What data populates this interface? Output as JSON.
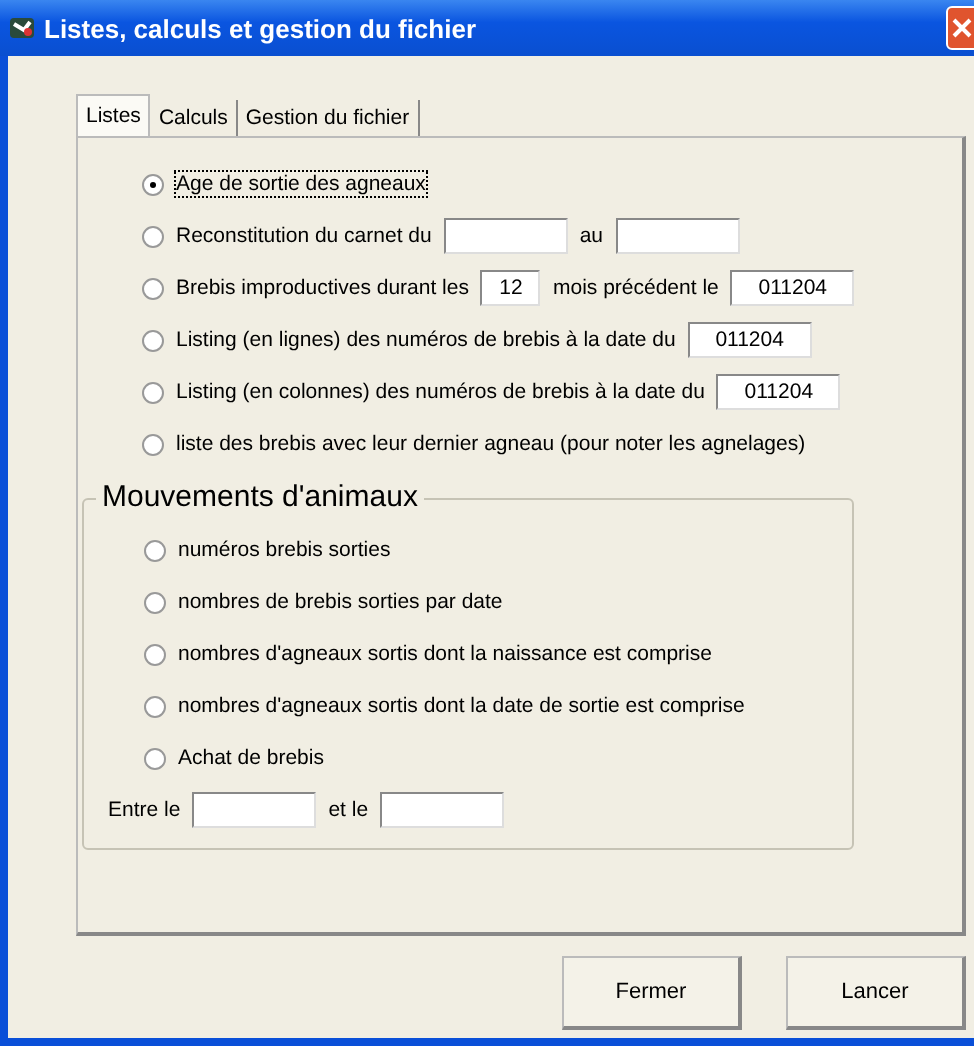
{
  "window": {
    "title": "Listes, calculs et gestion du fichier"
  },
  "tabs": [
    {
      "label": "Listes",
      "selected": true
    },
    {
      "label": "Calculs",
      "selected": false
    },
    {
      "label": "Gestion du fichier",
      "selected": false
    }
  ],
  "options": [
    {
      "selected": true,
      "parts": [
        {
          "kind": "text",
          "text": "Age de sortie des agneaux"
        }
      ]
    },
    {
      "selected": false,
      "parts": [
        {
          "kind": "text",
          "text": "Reconstitution du carnet du"
        },
        {
          "kind": "field"
        },
        {
          "kind": "text",
          "text": "au"
        },
        {
          "kind": "field"
        }
      ]
    },
    {
      "selected": false,
      "parts": [
        {
          "kind": "text",
          "text": "Brebis improductives durant les"
        },
        {
          "kind": "small_field",
          "value": "12"
        },
        {
          "kind": "text",
          "text": "mois précédent le"
        },
        {
          "kind": "field",
          "value": "011204"
        }
      ]
    },
    {
      "selected": false,
      "parts": [
        {
          "kind": "text",
          "text": "Listing (en lignes) des numéros de brebis à la date du"
        },
        {
          "kind": "field",
          "value": "011204"
        }
      ]
    },
    {
      "selected": false,
      "parts": [
        {
          "kind": "text",
          "text": "Listing (en colonnes) des numéros de brebis à la date du"
        },
        {
          "kind": "field",
          "value": "011204"
        }
      ]
    },
    {
      "selected": false,
      "parts": [
        {
          "kind": "text",
          "text": "liste des brebis avec leur dernier agneau (pour noter  les agnelages)"
        }
      ]
    }
  ],
  "group": {
    "title": "Mouvements d'animaux",
    "options": [
      {
        "label": "numéros brebis sorties",
        "selected": false
      },
      {
        "label": "nombres de brebis sorties par date",
        "selected": false
      },
      {
        "label": "nombres d'agneaux sortis dont la naissance est comprise",
        "selected": false
      },
      {
        "label": "nombres d'agneaux sortis dont la date de sortie est comprise",
        "selected": false
      },
      {
        "label": "Achat de brebis",
        "selected": false
      }
    ],
    "range": [
      {
        "kind": "text",
        "text": "Entre le"
      },
      {
        "kind": "field"
      },
      {
        "kind": "text",
        "text": "et le"
      },
      {
        "kind": "field"
      }
    ]
  },
  "buttons": [
    "Fermer",
    "Lancer"
  ]
}
